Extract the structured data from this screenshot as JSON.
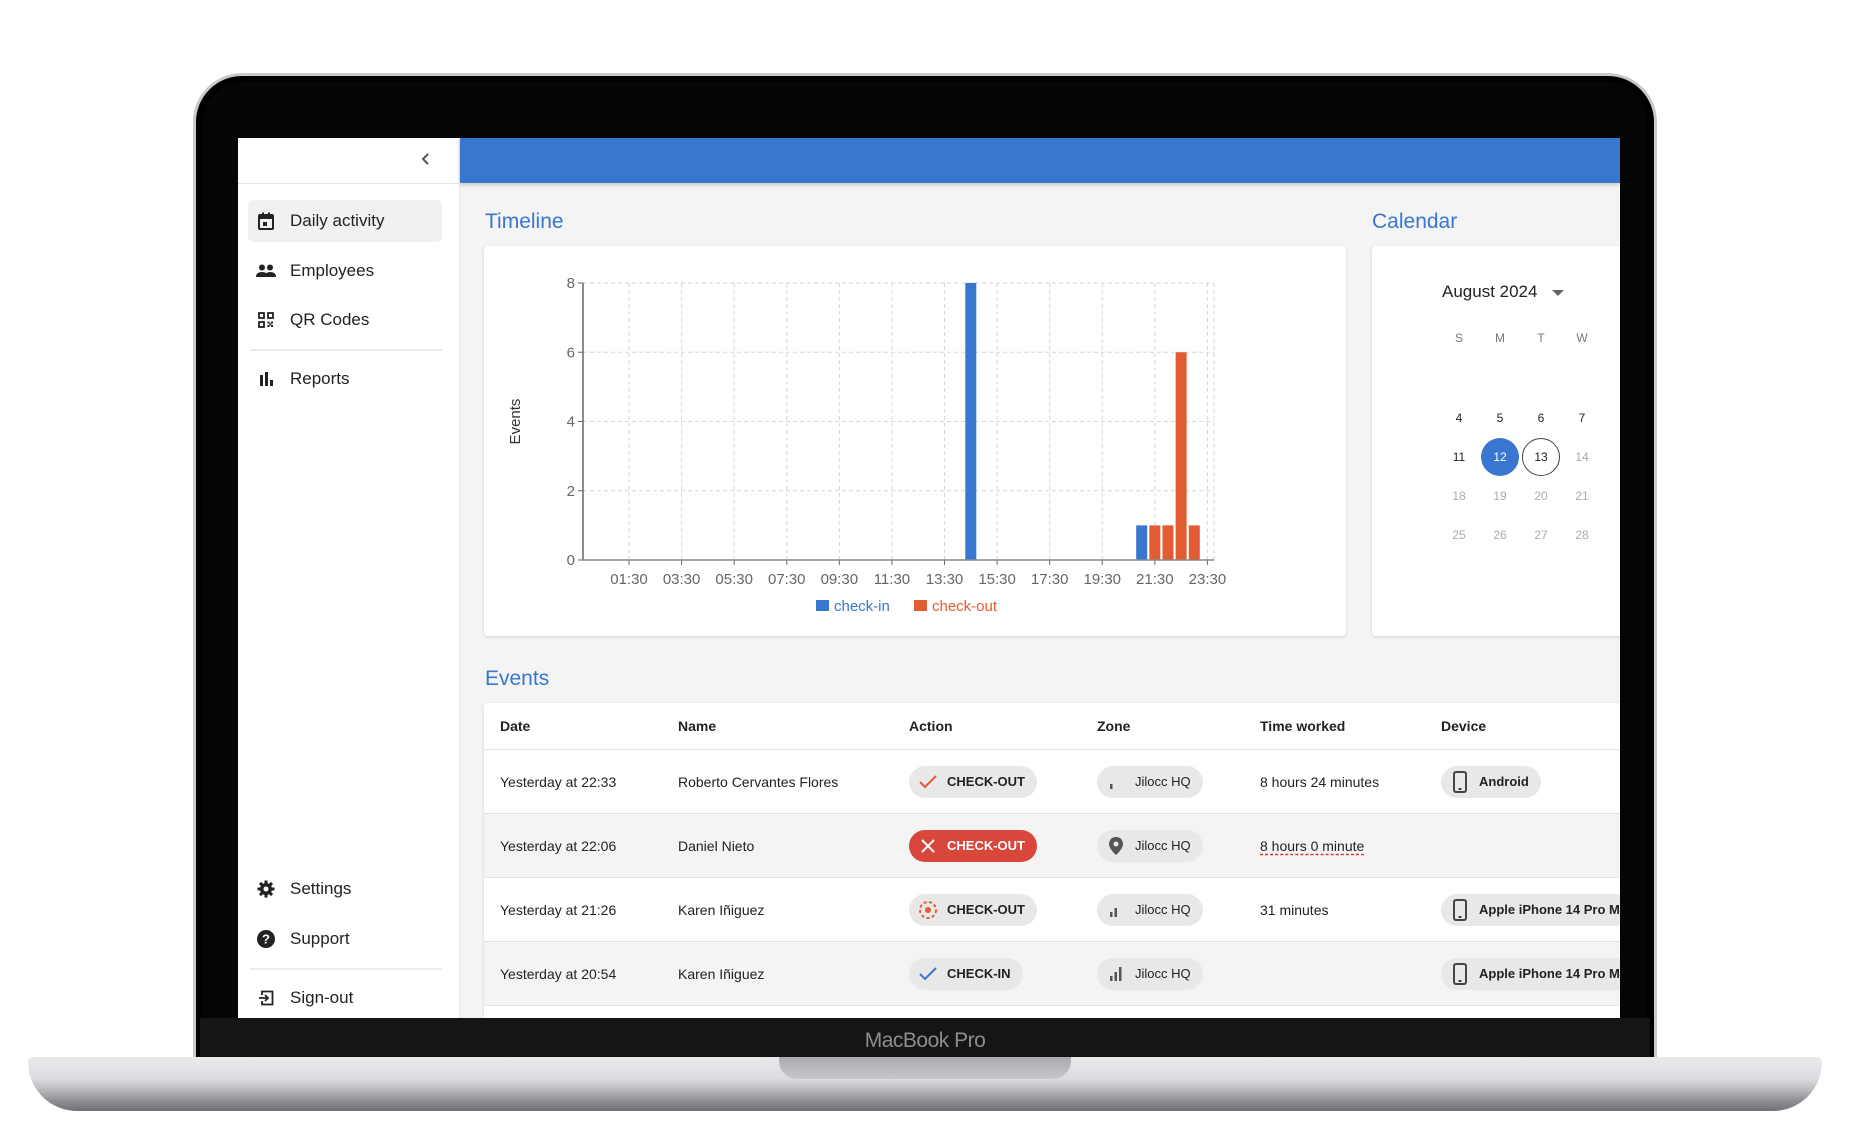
{
  "device": {
    "label": "MacBook Pro"
  },
  "sidebar": {
    "collapse_icon": "chevron-left-icon",
    "items": [
      {
        "label": "Daily activity",
        "icon": "calendar-icon",
        "active": true
      },
      {
        "label": "Employees",
        "icon": "people-icon",
        "active": false
      },
      {
        "label": "QR Codes",
        "icon": "qr-code-icon",
        "active": false
      },
      {
        "label": "Reports",
        "icon": "bar-chart-icon",
        "active": false
      }
    ],
    "bottom_items": [
      {
        "label": "Settings",
        "icon": "gear-icon"
      },
      {
        "label": "Support",
        "icon": "help-icon"
      },
      {
        "label": "Sign-out",
        "icon": "sign-out-icon"
      }
    ]
  },
  "header": {
    "color": "#3876cf"
  },
  "timeline": {
    "title": "Timeline"
  },
  "chart_data": {
    "type": "bar",
    "title": "",
    "xlabel": "",
    "ylabel": "Events",
    "ylim": [
      0,
      8
    ],
    "yticks": [
      0,
      2,
      4,
      6,
      8
    ],
    "xlim_hours": [
      -0.25,
      23.75
    ],
    "xticks": [
      "01:30",
      "03:30",
      "05:30",
      "07:30",
      "09:30",
      "11:30",
      "13:30",
      "15:30",
      "17:30",
      "19:30",
      "21:30",
      "23:30"
    ],
    "grid": true,
    "legend_position": "bottom-center",
    "series": [
      {
        "name": "check-in",
        "color": "#3876cf",
        "points": [
          {
            "time": "14:30",
            "value": 8
          },
          {
            "time": "21:00",
            "value": 1
          }
        ]
      },
      {
        "name": "check-out",
        "color": "#e25c33",
        "points": [
          {
            "time": "21:30",
            "value": 1
          },
          {
            "time": "22:00",
            "value": 1
          },
          {
            "time": "22:30",
            "value": 6
          },
          {
            "time": "23:00",
            "value": 1
          }
        ]
      }
    ]
  },
  "calendar": {
    "title": "Calendar",
    "month_label": "August 2024",
    "weekdays": [
      "S",
      "M",
      "T",
      "W"
    ],
    "weeks": [
      [
        {
          "d": "4"
        },
        {
          "d": "5"
        },
        {
          "d": "6"
        },
        {
          "d": "7"
        }
      ],
      [
        {
          "d": "11"
        },
        {
          "d": "12",
          "selected": true
        },
        {
          "d": "13",
          "today": true
        },
        {
          "d": "14",
          "dim": true
        }
      ],
      [
        {
          "d": "18",
          "dim": true
        },
        {
          "d": "19",
          "dim": true
        },
        {
          "d": "20",
          "dim": true
        },
        {
          "d": "21",
          "dim": true
        }
      ],
      [
        {
          "d": "25",
          "dim": true
        },
        {
          "d": "26",
          "dim": true
        },
        {
          "d": "27",
          "dim": true
        },
        {
          "d": "28",
          "dim": true
        }
      ]
    ]
  },
  "events": {
    "title": "Events",
    "columns": [
      "Date",
      "Name",
      "Action",
      "Zone",
      "Time worked",
      "Device"
    ],
    "rows": [
      {
        "date": "Yesterday at 22:33",
        "name": "Roberto Cervantes Flores",
        "action": "CHECK-OUT",
        "action_icon": "check-icon",
        "action_style": "orange-check",
        "zone": "Jilocc HQ",
        "zone_icon": "signal-weak-icon",
        "time_worked": "8 hours 24 minutes",
        "time_flag": false,
        "device": "Android"
      },
      {
        "date": "Yesterday at 22:06",
        "name": "Daniel Nieto",
        "action": "CHECK-OUT",
        "action_icon": "close-icon",
        "action_style": "error",
        "zone": "Jilocc HQ",
        "zone_icon": "location-pin-icon",
        "time_worked": "8 hours 0 minute",
        "time_flag": true,
        "device": ""
      },
      {
        "date": "Yesterday at 21:26",
        "name": "Karen Iñiguez",
        "action": "CHECK-OUT",
        "action_icon": "target-dashed-icon",
        "action_style": "orange-target",
        "zone": "Jilocc HQ",
        "zone_icon": "signal-medium-icon",
        "time_worked": "31 minutes",
        "time_flag": false,
        "device": "Apple iPhone 14 Pro M"
      },
      {
        "date": "Yesterday at 20:54",
        "name": "Karen Iñiguez",
        "action": "CHECK-IN",
        "action_icon": "check-icon",
        "action_style": "blue-check",
        "zone": "Jilocc HQ",
        "zone_icon": "signal-strong-icon",
        "time_worked": "",
        "time_flag": false,
        "device": "Apple iPhone 14 Pro M"
      }
    ]
  }
}
